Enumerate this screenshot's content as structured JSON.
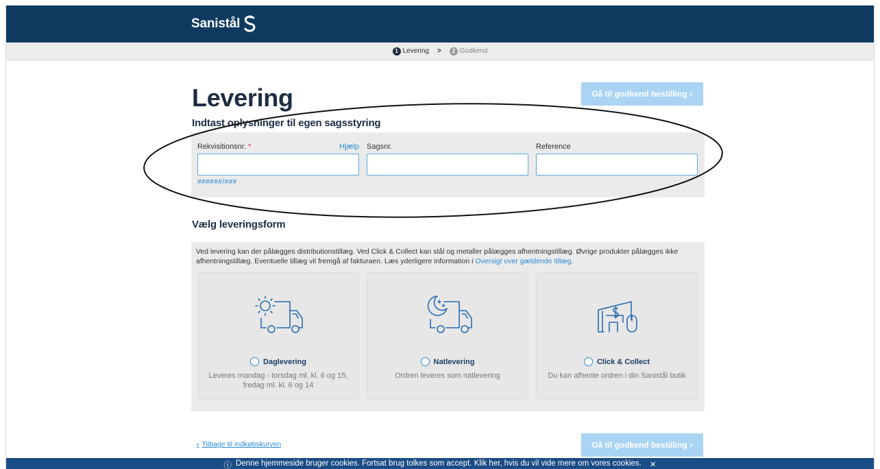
{
  "header": {
    "brand": "Sanistål",
    "logo_icon": "sanistal-s-logo-icon"
  },
  "steps": [
    {
      "number": "1",
      "label": "Levering",
      "active": true
    },
    {
      "number": "2",
      "label": "Godkend",
      "active": false
    }
  ],
  "page": {
    "title": "Levering",
    "next_button": "Gå til godkend bestilling",
    "next_chevron": "›"
  },
  "case_section": {
    "heading": "Indtast oplysninger til egen sagsstyring",
    "fields": [
      {
        "label": "Rekvisitionsnr.",
        "required": "*",
        "help": "Hjælp",
        "value": "",
        "hint": "######/###"
      },
      {
        "label": "Sagsnr.",
        "value": ""
      },
      {
        "label": "Reference",
        "value": ""
      }
    ]
  },
  "delivery_section": {
    "heading": "Vælg leveringsform",
    "info_text": "Ved levering kan der pålægges distributionstillæg. Ved Click & Collect kan stål og metaller pålægges afhentningstillæg. Øvrige produkter pålægges ikke afhentningstillæg. Eventuelle tillæg vil fremgå af fakturaen. Læs yderligere information i",
    "info_link": "Oversigt over gældende tillæg.",
    "options": [
      {
        "name": "Daglevering",
        "desc": "Leveres mandag - torsdag ml. kl. 6 og 15, fredag ml. kl. 6 og 14",
        "icon": "day-delivery-truck-icon",
        "selected": false
      },
      {
        "name": "Natlevering",
        "desc": "Ordren leveres som natlevering",
        "icon": "night-delivery-truck-icon",
        "selected": false
      },
      {
        "name": "Click & Collect",
        "desc": "Du kan afhente ordren i din Sanistål butik",
        "icon": "click-and-collect-store-icon",
        "selected": false
      }
    ]
  },
  "footer": {
    "back_chevron": "‹",
    "back_link": "Tilbage til indkøbskurven",
    "cookie_text": "Denne hjemmeside bruger cookies. Fortsat brug tolkes som accept. Klik her, hvis du vil vide mere om vores cookies.",
    "cookie_close": "✕",
    "info_symbol": "ⓘ"
  },
  "colors": {
    "header": "#0f3a60",
    "accent": "#2a8ad4",
    "button": "#a9d4f3",
    "cookie": "#1a4c85"
  }
}
